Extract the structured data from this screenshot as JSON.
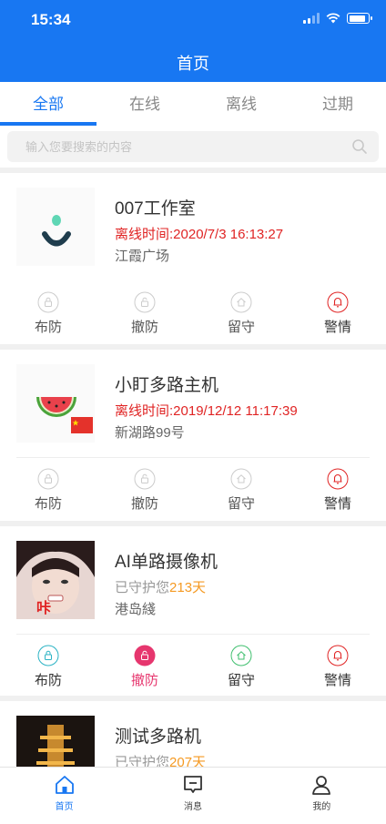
{
  "status_bar": {
    "time": "15:34"
  },
  "header": {
    "title": "首页"
  },
  "tabs": [
    {
      "label": "全部",
      "active": true
    },
    {
      "label": "在线",
      "active": false
    },
    {
      "label": "离线",
      "active": false
    },
    {
      "label": "过期",
      "active": false
    }
  ],
  "search": {
    "placeholder": "输入您要搜索的内容",
    "value": ""
  },
  "devices": [
    {
      "name": "007工作室",
      "status_text": "离线时间:2020/7/3 16:13:27",
      "location": "江霞广场",
      "actions": [
        "布防",
        "撤防",
        "留守",
        "警情"
      ]
    },
    {
      "name": "小盯多路主机",
      "status_text": "离线时间:2019/12/12 11:17:39",
      "location": "新湖路99号",
      "actions": [
        "布防",
        "撤防",
        "留守",
        "警情"
      ]
    },
    {
      "name": "AI单路摄像机",
      "status_prefix": "已守护您",
      "days": "213天",
      "location": "港岛綫",
      "thumb_caption": "咔",
      "actions": [
        "布防",
        "撤防",
        "留守",
        "警情"
      ]
    },
    {
      "name": "测试多路机",
      "status_prefix": "已守护您",
      "days": "207天"
    }
  ],
  "bottom_nav": [
    {
      "label": "首页",
      "active": true
    },
    {
      "label": "消息",
      "active": false
    },
    {
      "label": "我的",
      "active": false
    }
  ],
  "colors": {
    "primary": "#1877f2",
    "offline_red": "#e02424",
    "days_orange": "#f59a23",
    "disarm_pink": "#e6366e",
    "arm_teal": "#2bb3c4",
    "home_green": "#3fbf6e"
  }
}
